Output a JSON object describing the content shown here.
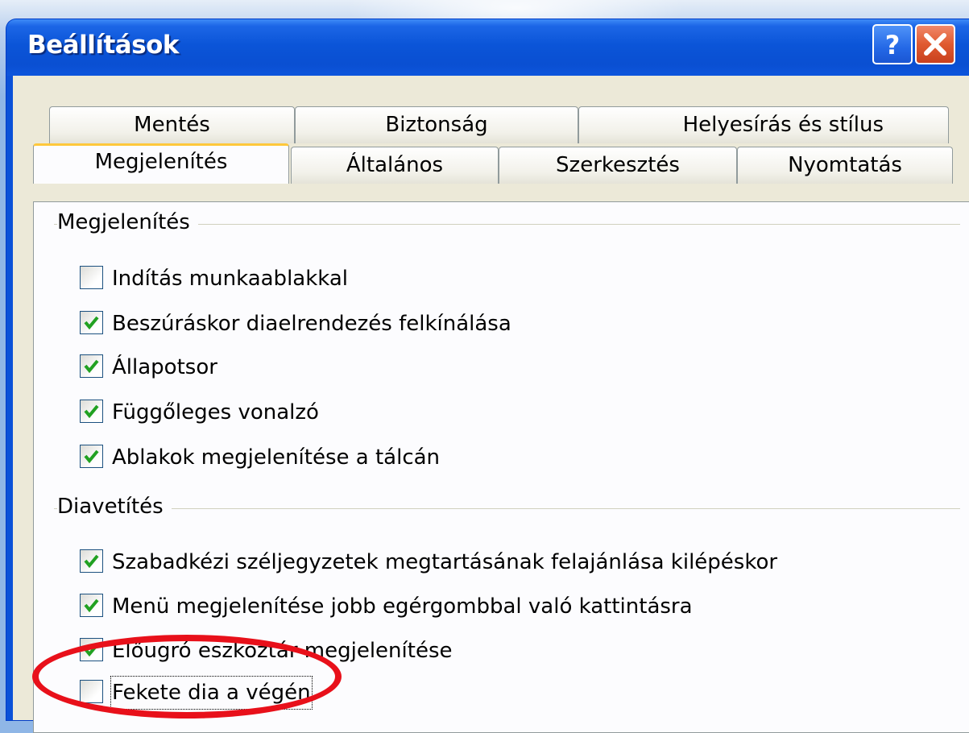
{
  "dialog": {
    "title": "Beállítások",
    "help_symbol": "?",
    "close_symbol": "✕"
  },
  "tabs_back_row": [
    {
      "label": "Mentés"
    },
    {
      "label": "Biztonság"
    },
    {
      "label": "Helyesírás és stílus"
    }
  ],
  "tabs_front_row": [
    {
      "label": "Megjelenítés",
      "active": true
    },
    {
      "label": "Általános",
      "active": false
    },
    {
      "label": "Szerkesztés",
      "active": false
    },
    {
      "label": "Nyomtatás",
      "active": false
    }
  ],
  "groups": {
    "display": {
      "title": "Megjelenítés",
      "options": [
        {
          "label": "Indítás munkaablakkal",
          "checked": false
        },
        {
          "label": "Beszúráskor diaelrendezés felkínálása",
          "checked": true
        },
        {
          "label": "Állapotsor",
          "checked": true
        },
        {
          "label": "Függőleges vonalzó",
          "checked": true
        },
        {
          "label": "Ablakok megjelenítése a tálcán",
          "checked": true
        }
      ]
    },
    "slideshow": {
      "title": "Diavetítés",
      "options": [
        {
          "label": "Szabadkézi széljegyzetek megtartásának felajánlása kilépéskor",
          "checked": true
        },
        {
          "label": "Menü megjelenítése jobb egérgombbal való kattintásra",
          "checked": true
        },
        {
          "label": "Előugró eszköztár megjelenítése",
          "checked": true
        },
        {
          "label": "Fekete dia a végén",
          "checked": false,
          "focused": true
        }
      ]
    }
  },
  "colors": {
    "titlebar": "#0a55d8",
    "dialog_face": "#ece9d8",
    "panel": "#fcfcfe",
    "checkmark": "#21a121",
    "active_tab_accent": "#ffc83c",
    "annotation_ring": "#e8101a"
  }
}
